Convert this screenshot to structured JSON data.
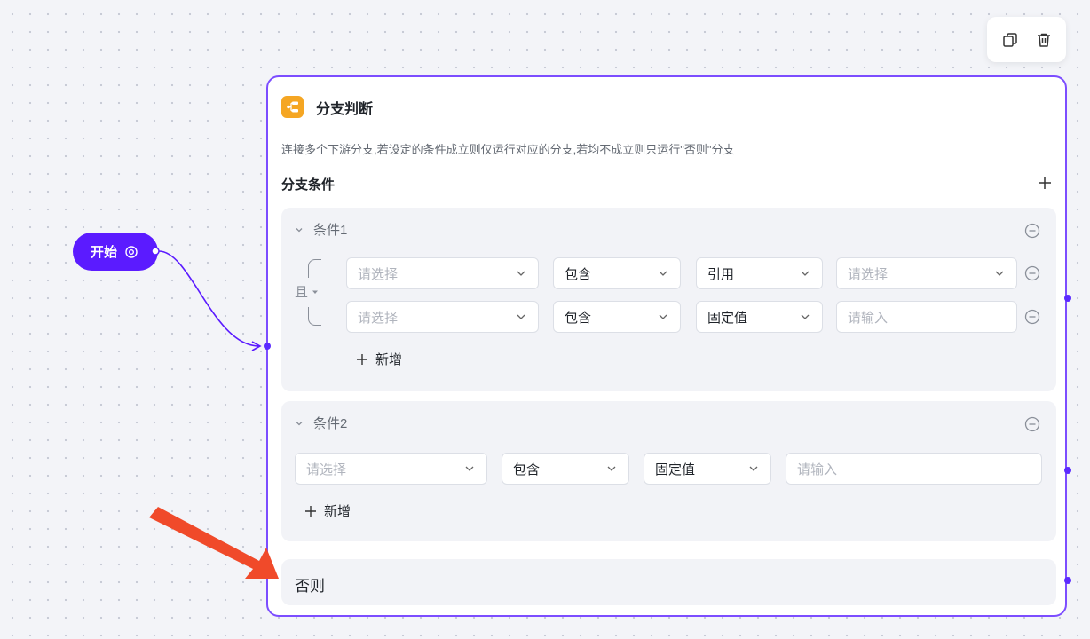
{
  "node": {
    "title": "分支判断",
    "description": "连接多个下游分支,若设定的条件成立则仅运行对应的分支,若均不成立则只运行\"否则\"分支",
    "section_title": "分支条件",
    "else_label": "否则"
  },
  "start_node": {
    "label": "开始"
  },
  "toolbar": {
    "copy_icon": "copy-icon",
    "delete_icon": "trash-icon"
  },
  "conditions": [
    {
      "title": "条件1",
      "logic": "且",
      "rows": [
        {
          "variable_placeholder": "请选择",
          "operator": "包含",
          "value_type": "引用",
          "value_placeholder": "请选择"
        },
        {
          "variable_placeholder": "请选择",
          "operator": "包含",
          "value_type": "固定值",
          "value_placeholder": "请输入"
        }
      ],
      "add_label": "新增"
    },
    {
      "title": "条件2",
      "rows": [
        {
          "variable_placeholder": "请选择",
          "operator": "包含",
          "value_type": "固定值",
          "value_placeholder": "请输入"
        }
      ],
      "add_label": "新增"
    }
  ],
  "colors": {
    "accent": "#7c4dff",
    "start": "#5b1bff",
    "node_icon": "#f5a623",
    "annotation_arrow": "#f04a2a"
  }
}
